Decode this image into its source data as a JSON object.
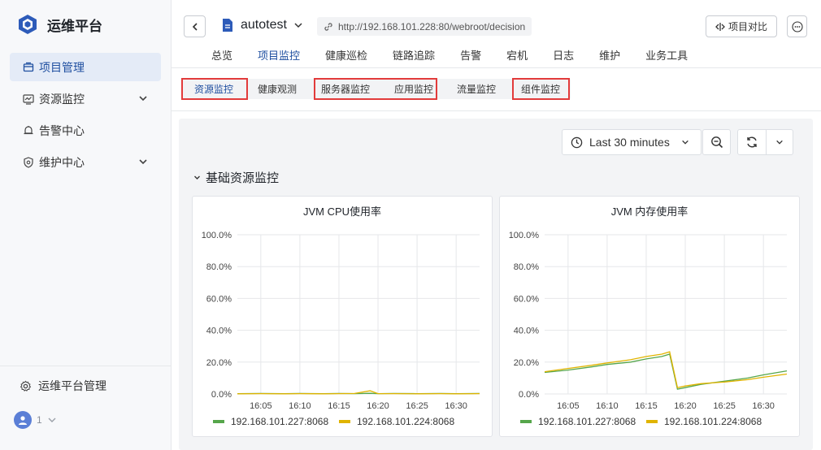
{
  "brand": {
    "name": "运维平台",
    "icon": "cube-logo-icon"
  },
  "sidebar": {
    "items": [
      {
        "label": "项目管理",
        "icon": "folder-icon",
        "active": true,
        "expandable": false
      },
      {
        "label": "资源监控",
        "icon": "monitor-chart-icon",
        "active": false,
        "expandable": true
      },
      {
        "label": "告警中心",
        "icon": "bell-icon",
        "active": false,
        "expandable": false
      },
      {
        "label": "维护中心",
        "icon": "shield-icon",
        "active": false,
        "expandable": true
      }
    ],
    "admin_label": "运维平台管理",
    "user_label": "1"
  },
  "header": {
    "project_name": "autotest",
    "url": "http://192.168.101.228:80/webroot/decision",
    "compare_label": "项目对比",
    "tabs": [
      "总览",
      "项目监控",
      "健康巡检",
      "链路追踪",
      "告警",
      "宕机",
      "日志",
      "维护",
      "业务工具"
    ],
    "active_tab": "项目监控"
  },
  "subtabs": {
    "items": [
      "资源监控",
      "健康观测",
      "服务器监控",
      "应用监控",
      "流量监控",
      "组件监控"
    ],
    "active": "资源监控"
  },
  "toolbar": {
    "time_range": "Last 30 minutes"
  },
  "section": {
    "title": "基础资源监控"
  },
  "accent_color": "#1f4fa0",
  "chart_data": [
    {
      "type": "line",
      "title": "JVM CPU使用率",
      "x": [
        "16:02",
        "16:05",
        "16:08",
        "16:10",
        "16:13",
        "16:15",
        "16:17",
        "16:19",
        "16:20",
        "16:22",
        "16:25",
        "16:28",
        "16:30",
        "16:33"
      ],
      "x_ticks": [
        "16:05",
        "16:10",
        "16:15",
        "16:20",
        "16:25",
        "16:30"
      ],
      "y_ticks": [
        "0.0%",
        "20.0%",
        "40.0%",
        "60.0%",
        "80.0%",
        "100.0%"
      ],
      "ylim": [
        0,
        100
      ],
      "series": [
        {
          "name": "192.168.101.227:8068",
          "color": "#56a64b",
          "values": [
            0.2,
            0.3,
            0.2,
            0.3,
            0.2,
            0.3,
            0.2,
            0.4,
            0.2,
            0.3,
            0.2,
            0.3,
            0.2,
            0.3
          ]
        },
        {
          "name": "192.168.101.224:8068",
          "color": "#e0b400",
          "values": [
            0.1,
            0.2,
            0.1,
            0.2,
            0.1,
            0.2,
            0.3,
            2.0,
            0.2,
            0.2,
            0.1,
            0.2,
            0.1,
            0.2
          ]
        }
      ]
    },
    {
      "type": "line",
      "title": "JVM 内存使用率",
      "x": [
        "16:02",
        "16:05",
        "16:08",
        "16:10",
        "16:13",
        "16:15",
        "16:17",
        "16:18",
        "16:19",
        "16:20",
        "16:22",
        "16:25",
        "16:28",
        "16:30",
        "16:33"
      ],
      "x_ticks": [
        "16:05",
        "16:10",
        "16:15",
        "16:20",
        "16:25",
        "16:30"
      ],
      "y_ticks": [
        "0.0%",
        "20.0%",
        "40.0%",
        "60.0%",
        "80.0%",
        "100.0%"
      ],
      "ylim": [
        0,
        100
      ],
      "series": [
        {
          "name": "192.168.101.227:8068",
          "color": "#56a64b",
          "values": [
            13.5,
            15,
            17,
            18.5,
            20,
            22,
            23.5,
            25,
            3,
            4,
            6,
            8,
            10,
            12,
            14.5
          ]
        },
        {
          "name": "192.168.101.224:8068",
          "color": "#e0b400",
          "values": [
            14,
            16,
            18,
            19.5,
            21.5,
            23.5,
            25,
            26.5,
            4,
            5,
            6.5,
            7.5,
            9,
            10.5,
            12.5
          ]
        }
      ]
    }
  ]
}
